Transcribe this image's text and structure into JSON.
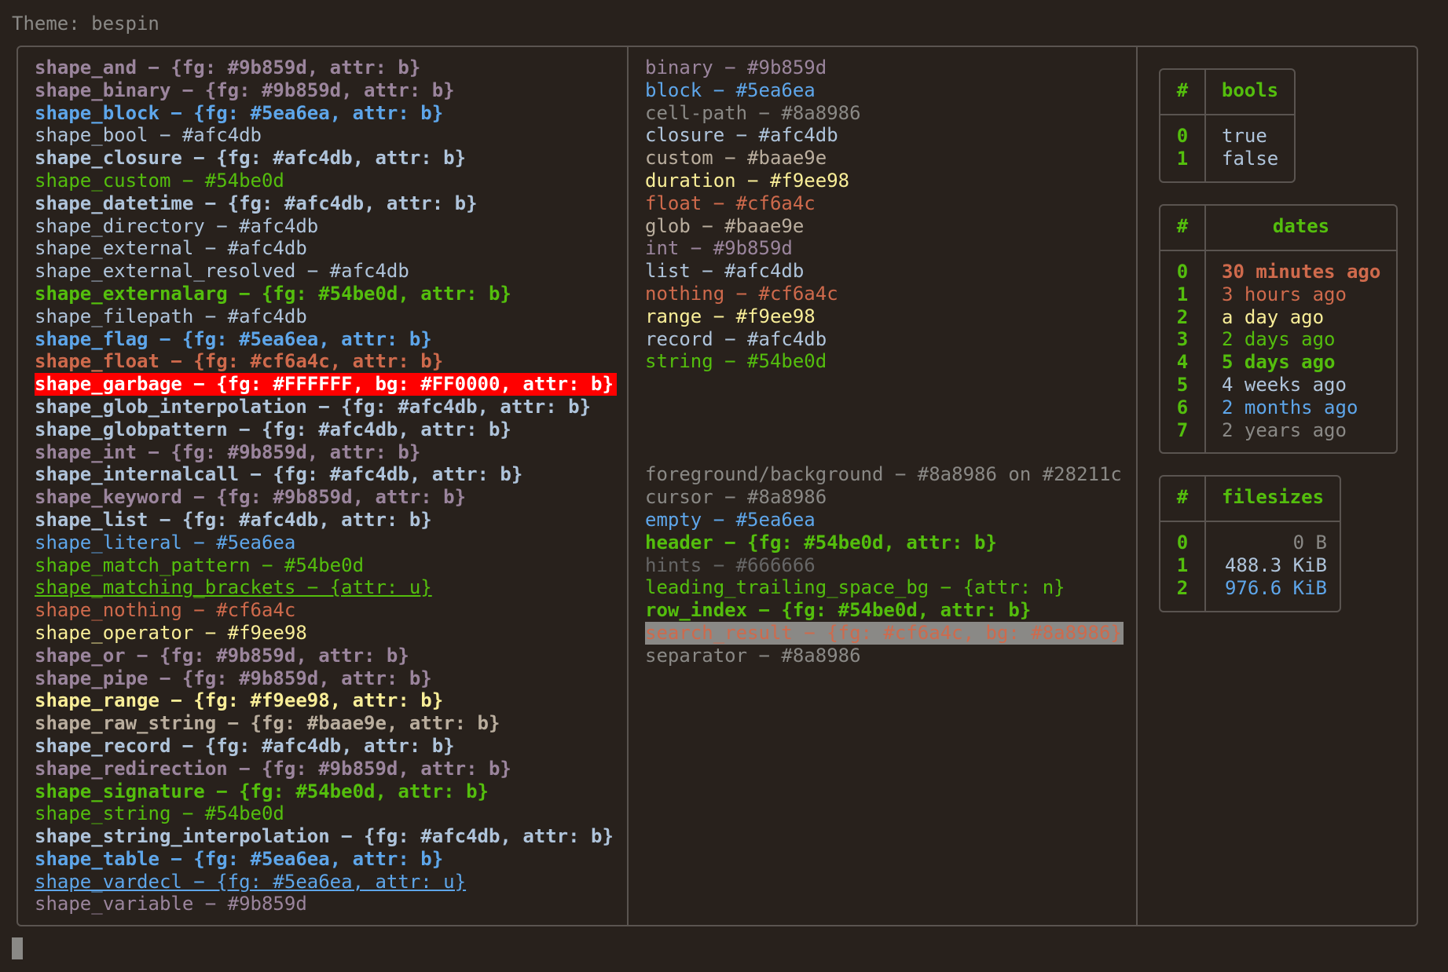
{
  "theme_title": "Theme: bespin",
  "col1": [
    {
      "text": "shape_and − {fg: #9b859d, attr: b}",
      "color": "#9b859d",
      "bold": true
    },
    {
      "text": "shape_binary − {fg: #9b859d, attr: b}",
      "color": "#9b859d",
      "bold": true
    },
    {
      "text": "shape_block − {fg: #5ea6ea, attr: b}",
      "color": "#5ea6ea",
      "bold": true
    },
    {
      "text": "shape_bool − #afc4db",
      "color": "#afc4db"
    },
    {
      "text": "shape_closure − {fg: #afc4db, attr: b}",
      "color": "#afc4db",
      "bold": true
    },
    {
      "text": "shape_custom − #54be0d",
      "color": "#54be0d"
    },
    {
      "text": "shape_datetime − {fg: #afc4db, attr: b}",
      "color": "#afc4db",
      "bold": true
    },
    {
      "text": "shape_directory − #afc4db",
      "color": "#afc4db"
    },
    {
      "text": "shape_external − #afc4db",
      "color": "#afc4db"
    },
    {
      "text": "shape_external_resolved − #afc4db",
      "color": "#afc4db"
    },
    {
      "text": "shape_externalarg − {fg: #54be0d, attr: b}",
      "color": "#54be0d",
      "bold": true
    },
    {
      "text": "shape_filepath − #afc4db",
      "color": "#afc4db"
    },
    {
      "text": "shape_flag − {fg: #5ea6ea, attr: b}",
      "color": "#5ea6ea",
      "bold": true
    },
    {
      "text": "shape_float − {fg: #cf6a4c, attr: b}",
      "color": "#cf6a4c",
      "bold": true
    },
    {
      "text": "shape_garbage − {fg: #FFFFFF, bg: #FF0000, attr: b}",
      "color": "#FFFFFF",
      "bold": true,
      "garbage": true
    },
    {
      "text": "shape_glob_interpolation − {fg: #afc4db, attr: b}",
      "color": "#afc4db",
      "bold": true
    },
    {
      "text": "shape_globpattern − {fg: #afc4db, attr: b}",
      "color": "#afc4db",
      "bold": true
    },
    {
      "text": "shape_int − {fg: #9b859d, attr: b}",
      "color": "#9b859d",
      "bold": true
    },
    {
      "text": "shape_internalcall − {fg: #afc4db, attr: b}",
      "color": "#afc4db",
      "bold": true
    },
    {
      "text": "shape_keyword − {fg: #9b859d, attr: b}",
      "color": "#9b859d",
      "bold": true
    },
    {
      "text": "shape_list − {fg: #afc4db, attr: b}",
      "color": "#afc4db",
      "bold": true
    },
    {
      "text": "shape_literal − #5ea6ea",
      "color": "#5ea6ea"
    },
    {
      "text": "shape_match_pattern − #54be0d",
      "color": "#54be0d"
    },
    {
      "text": "shape_matching_brackets − {attr: u}",
      "color": "#54be0d",
      "underline": true
    },
    {
      "text": "shape_nothing − #cf6a4c",
      "color": "#cf6a4c"
    },
    {
      "text": "shape_operator − #f9ee98",
      "color": "#f9ee98"
    },
    {
      "text": "shape_or − {fg: #9b859d, attr: b}",
      "color": "#9b859d",
      "bold": true
    },
    {
      "text": "shape_pipe − {fg: #9b859d, attr: b}",
      "color": "#9b859d",
      "bold": true
    },
    {
      "text": "shape_range − {fg: #f9ee98, attr: b}",
      "color": "#f9ee98",
      "bold": true
    },
    {
      "text": "shape_raw_string − {fg: #baae9e, attr: b}",
      "color": "#baae9e",
      "bold": true
    },
    {
      "text": "shape_record − {fg: #afc4db, attr: b}",
      "color": "#afc4db",
      "bold": true
    },
    {
      "text": "shape_redirection − {fg: #9b859d, attr: b}",
      "color": "#9b859d",
      "bold": true
    },
    {
      "text": "shape_signature − {fg: #54be0d, attr: b}",
      "color": "#54be0d",
      "bold": true
    },
    {
      "text": "shape_string − #54be0d",
      "color": "#54be0d"
    },
    {
      "text": "shape_string_interpolation − {fg: #afc4db, attr: b}",
      "color": "#afc4db",
      "bold": true
    },
    {
      "text": "shape_table − {fg: #5ea6ea, attr: b}",
      "color": "#5ea6ea",
      "bold": true
    },
    {
      "text": "shape_vardecl − {fg: #5ea6ea, attr: u}",
      "color": "#5ea6ea",
      "underline": true
    },
    {
      "text": "shape_variable − #9b859d",
      "color": "#9b859d"
    }
  ],
  "col2": [
    {
      "text": "binary − #9b859d",
      "color": "#9b859d"
    },
    {
      "text": "block − #5ea6ea",
      "color": "#5ea6ea"
    },
    {
      "text": "cell-path − #8a8986",
      "color": "#8a8986"
    },
    {
      "text": "closure − #afc4db",
      "color": "#afc4db"
    },
    {
      "text": "custom − #baae9e",
      "color": "#baae9e"
    },
    {
      "text": "duration − #f9ee98",
      "color": "#f9ee98"
    },
    {
      "text": "float − #cf6a4c",
      "color": "#cf6a4c"
    },
    {
      "text": "glob − #baae9e",
      "color": "#baae9e"
    },
    {
      "text": "int − #9b859d",
      "color": "#9b859d"
    },
    {
      "text": "list − #afc4db",
      "color": "#afc4db"
    },
    {
      "text": "nothing − #cf6a4c",
      "color": "#cf6a4c"
    },
    {
      "text": "range − #f9ee98",
      "color": "#f9ee98"
    },
    {
      "text": "record − #afc4db",
      "color": "#afc4db"
    },
    {
      "text": "string − #54be0d",
      "color": "#54be0d"
    },
    {
      "text": "",
      "color": "#afc4db"
    },
    {
      "text": "",
      "color": "#afc4db"
    },
    {
      "text": "",
      "color": "#afc4db"
    },
    {
      "text": "",
      "color": "#afc4db"
    },
    {
      "text": "foreground/background − #8a8986 on #28211c",
      "color": "#8a8986"
    },
    {
      "text": "cursor − #8a8986",
      "color": "#8a8986"
    },
    {
      "text": "empty − #5ea6ea",
      "color": "#5ea6ea"
    },
    {
      "text": "header − {fg: #54be0d, attr: b}",
      "color": "#54be0d",
      "bold": true
    },
    {
      "text": "hints − #666666",
      "color": "#666666"
    },
    {
      "text": "leading_trailing_space_bg − {attr: n}",
      "color": "#54be0d"
    },
    {
      "text": "row_index − {fg: #54be0d, attr: b}",
      "color": "#54be0d",
      "bold": true
    },
    {
      "text": "search_result − {fg: #cf6a4c, bg: #8a8986}",
      "color": "#cf6a4c",
      "search": true
    },
    {
      "text": "separator − #8a8986",
      "color": "#8a8986"
    }
  ],
  "bools": {
    "idx_header": "#",
    "header": "bools",
    "rows": [
      {
        "i": "0",
        "v": "true",
        "color": "#afc4db"
      },
      {
        "i": "1",
        "v": "false",
        "color": "#afc4db"
      }
    ]
  },
  "dates": {
    "idx_header": "#",
    "header": "dates",
    "rows": [
      {
        "i": "0",
        "v": "30 minutes ago",
        "color": "#cf6a4c",
        "bold": true
      },
      {
        "i": "1",
        "v": "3 hours ago",
        "color": "#cf6a4c"
      },
      {
        "i": "2",
        "v": "a day ago",
        "color": "#f9ee98"
      },
      {
        "i": "3",
        "v": "2 days ago",
        "color": "#54be0d"
      },
      {
        "i": "4",
        "v": "5 days ago",
        "color": "#54be0d",
        "bold": true
      },
      {
        "i": "5",
        "v": "4 weeks ago",
        "color": "#afc4db"
      },
      {
        "i": "6",
        "v": "2 months ago",
        "color": "#5ea6ea"
      },
      {
        "i": "7",
        "v": "2 years ago",
        "color": "#8a8986"
      }
    ]
  },
  "filesizes": {
    "idx_header": "#",
    "header": "filesizes",
    "rows": [
      {
        "i": "0",
        "v": "0 B",
        "color": "#8a8986"
      },
      {
        "i": "1",
        "v": "488.3 KiB",
        "color": "#afc4db"
      },
      {
        "i": "2",
        "v": "976.6 KiB",
        "color": "#5ea6ea"
      }
    ]
  }
}
